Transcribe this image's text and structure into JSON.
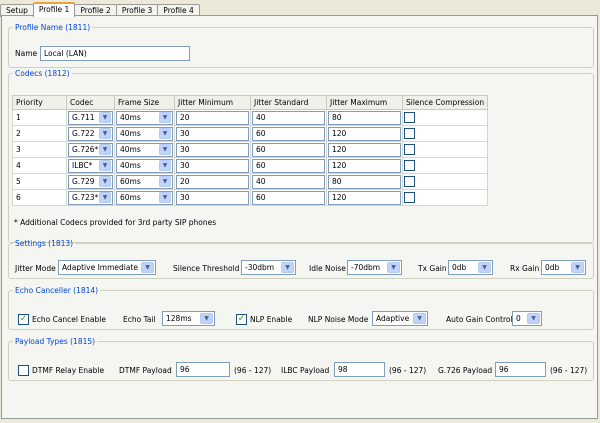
{
  "tabs": [
    "Setup",
    "Profile 1",
    "Profile 2",
    "Profile 3",
    "Profile 4"
  ],
  "profile_name": {
    "title": "Profile Name (1811)",
    "label": "Name",
    "value": "Local (LAN)"
  },
  "codecs": {
    "title": "Codecs (1812)",
    "headers": [
      "Priority",
      "Codec",
      "Frame Size",
      "Jitter Minimum",
      "Jitter Standard",
      "Jitter Maximum",
      "Silence Compression"
    ],
    "rows": [
      {
        "priority": "1",
        "codec": "G.711",
        "frame": "40ms",
        "jmin": "20",
        "jstd": "40",
        "jmax": "80",
        "silence": false
      },
      {
        "priority": "2",
        "codec": "G.722",
        "frame": "40ms",
        "jmin": "30",
        "jstd": "60",
        "jmax": "120",
        "silence": false
      },
      {
        "priority": "3",
        "codec": "G.726*",
        "frame": "40ms",
        "jmin": "30",
        "jstd": "60",
        "jmax": "120",
        "silence": false
      },
      {
        "priority": "4",
        "codec": "ILBC*",
        "frame": "40ms",
        "jmin": "30",
        "jstd": "60",
        "jmax": "120",
        "silence": false
      },
      {
        "priority": "5",
        "codec": "G.729",
        "frame": "60ms",
        "jmin": "20",
        "jstd": "40",
        "jmax": "80",
        "silence": false
      },
      {
        "priority": "6",
        "codec": "G.723*",
        "frame": "60ms",
        "jmin": "30",
        "jstd": "60",
        "jmax": "120",
        "silence": false
      }
    ],
    "footnote": "* Additional Codecs provided for 3rd party SIP phones"
  },
  "settings": {
    "title": "Settings (1813)",
    "jitter_mode_label": "Jitter Mode",
    "jitter_mode_value": "Adaptive Immediate",
    "silence_threshold_label": "Silence Threshold",
    "silence_threshold_value": "-30dbm",
    "idle_noise_label": "Idle Noise",
    "idle_noise_value": "-70dbm",
    "tx_gain_label": "Tx Gain",
    "tx_gain_value": "0db",
    "rx_gain_label": "Rx Gain",
    "rx_gain_value": "0db"
  },
  "echo": {
    "title": "Echo Canceller (1814)",
    "echo_cancel_label": "Echo Cancel Enable",
    "echo_cancel_checked": true,
    "echo_tail_label": "Echo Tail",
    "echo_tail_value": "128ms",
    "nlp_enable_label": "NLP Enable",
    "nlp_enable_checked": true,
    "nlp_noise_label": "NLP Noise Mode",
    "nlp_noise_value": "Adaptive",
    "agc_label": "Auto Gain Control",
    "agc_value": "0"
  },
  "payload": {
    "title": "Payload Types (1815)",
    "dtmf_relay_label": "DTMF Relay Enable",
    "dtmf_relay_checked": false,
    "dtmf_payload_label": "DTMF Payload",
    "dtmf_payload_value": "96",
    "dtmf_range": "(96 - 127)",
    "ilbc_payload_label": "ILBC Payload",
    "ilbc_payload_value": "98",
    "ilbc_range": "(96 - 127)",
    "g726_payload_label": "G.726 Payload",
    "g726_payload_value": "96",
    "g726_range": "(96 - 127)"
  },
  "icons": {
    "dropdown": "chevron-down-icon",
    "check": "checkmark-icon"
  },
  "colors": {
    "group_title": "#0046d5",
    "active_tab_accent": "#e8a33b",
    "background": "#ece9d8"
  }
}
